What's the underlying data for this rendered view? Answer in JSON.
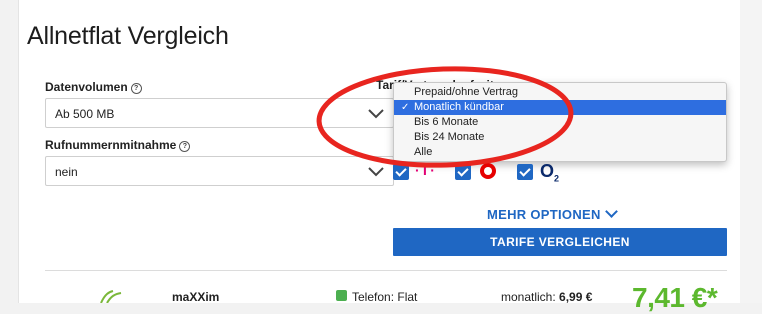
{
  "page": {
    "title": "Allnetflat Vergleich"
  },
  "filters": {
    "data_volume": {
      "label": "Datenvolumen",
      "help": "?",
      "value": "Ab 500 MB"
    },
    "number_porting": {
      "label": "Rufnummernmitnahme",
      "help": "?",
      "value": "nein"
    },
    "contract": {
      "label": "Tarif/Vertragslaufzeit",
      "options": [
        "Prepaid/ohne Vertrag",
        "Monatlich kündbar",
        "Bis 6 Monate",
        "Bis 24 Monate",
        "Alle"
      ],
      "selected": "Monatlich kündbar",
      "check": "✓"
    },
    "networks": {
      "telekom": {
        "label": "·T·",
        "checked": true
      },
      "vodafone": {
        "checked": true
      },
      "o2": {
        "label": "O",
        "sub": "2",
        "checked": true
      }
    },
    "more_options": "MEHR OPTIONEN",
    "compare_button": "TARIFE VERGLEICHEN"
  },
  "result": {
    "provider": "maXXim",
    "feature": "Telefon: Flat",
    "monthly_label": "monatlich:",
    "monthly_value": "6,99 €",
    "price": "7,41 €*"
  },
  "colors": {
    "accent": "#1f67c3",
    "annotation": "#e8251f",
    "price": "#5cb82e",
    "selected": "#2e6ee0"
  }
}
